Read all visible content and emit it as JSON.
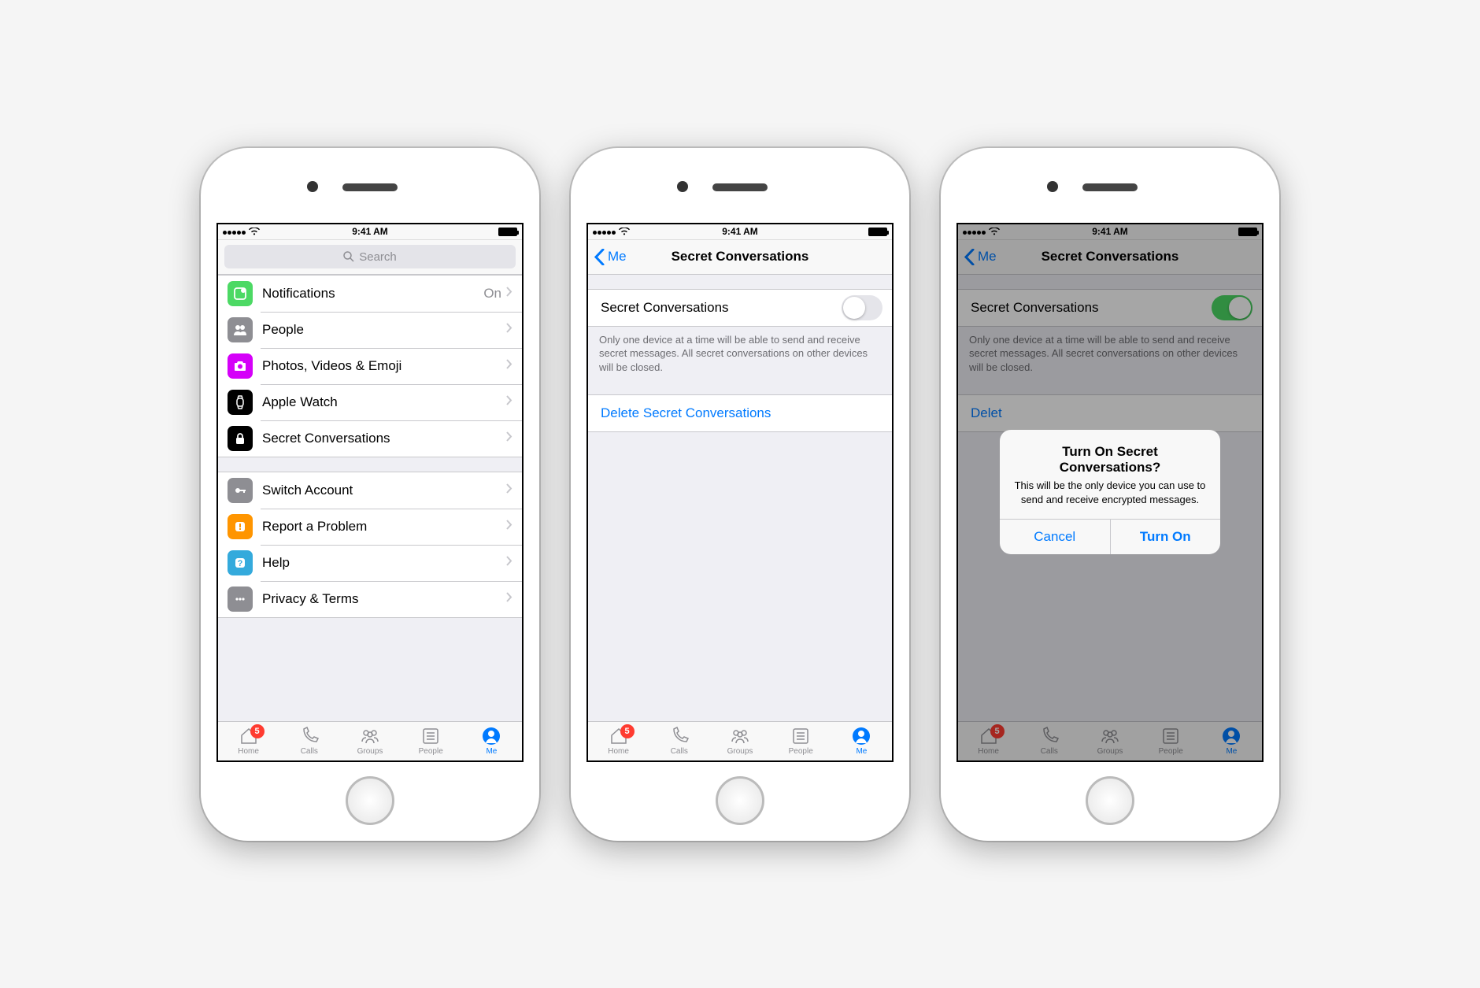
{
  "status": {
    "time": "9:41 AM"
  },
  "screen1": {
    "search_placeholder": "Search",
    "rows": {
      "notifications": {
        "label": "Notifications",
        "value": "On"
      },
      "people": {
        "label": "People"
      },
      "photos": {
        "label": "Photos, Videos & Emoji"
      },
      "watch": {
        "label": "Apple Watch"
      },
      "secret": {
        "label": "Secret Conversations"
      },
      "switch": {
        "label": "Switch Account"
      },
      "report": {
        "label": "Report a Problem"
      },
      "help": {
        "label": "Help"
      },
      "privacy": {
        "label": "Privacy & Terms"
      }
    }
  },
  "screen2": {
    "back": "Me",
    "title": "Secret Conversations",
    "toggle_label": "Secret Conversations",
    "toggle_state": "off",
    "footer": "Only one device at a time will be able to send and receive secret messages. All secret conversations on other devices will be closed.",
    "delete": "Delete Secret Conversations"
  },
  "screen3": {
    "back": "Me",
    "title": "Secret Conversations",
    "toggle_label": "Secret Conversations",
    "toggle_state": "on",
    "footer": "Only one device at a time will be able to send and receive secret messages. All secret conversations on other devices will be closed.",
    "delete_partial": "Delet",
    "alert": {
      "title": "Turn On Secret Conversations?",
      "msg": "This will be the only device you can use to send and receive encrypted messages.",
      "cancel": "Cancel",
      "confirm": "Turn On"
    }
  },
  "tabs": {
    "home": "Home",
    "calls": "Calls",
    "groups": "Groups",
    "people": "People",
    "me": "Me",
    "badge": "5"
  }
}
